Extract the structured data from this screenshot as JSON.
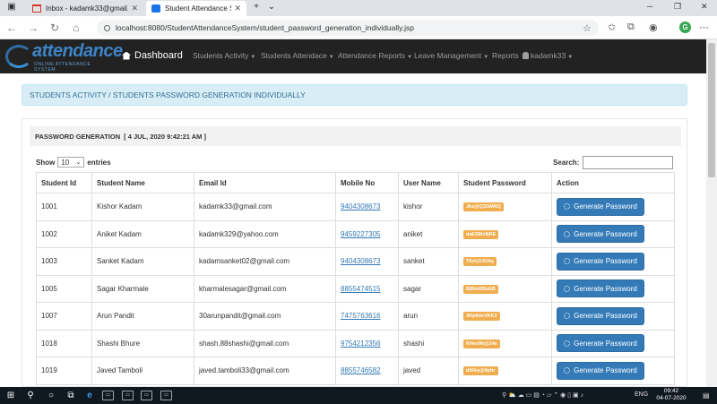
{
  "browser": {
    "tabs": [
      {
        "title": "Inbox - kadamk33@gmail.c",
        "active": false
      },
      {
        "title": "Student Attendance Sys",
        "active": true
      }
    ],
    "new_tab": "+",
    "url": "localhost:8080/StudentAttendanceSystem/student_password_generation_individually.jsp"
  },
  "navbar": {
    "logo_text": "attendance",
    "logo_sub": "ONLINE ATTENDANCE SYSTEM",
    "brand": "Dashboard",
    "items": [
      "Students Activity",
      "Students Attendace",
      "Attendance Reports",
      "Leave Management"
    ],
    "reports": "Reports",
    "user": "kadamk33"
  },
  "breadcrumb": "STUDENTS ACTIVITY / STUDENTS PASSWORD GENERATION INDIVIDUALLY",
  "panel": {
    "title": "PASSWORD GENERATION",
    "datetime": "[ 4 JUL, 2020 9:42:21 AM ]"
  },
  "table_controls": {
    "show_label": "Show",
    "show_value": "10",
    "entries_label": "entries",
    "search_label": "Search:"
  },
  "table": {
    "headers": [
      "Student Id",
      "Student Name",
      "Email Id",
      "Mobile No",
      "User Name",
      "Student Password",
      "Action"
    ],
    "action_label": "Generate Password",
    "rows": [
      {
        "id": "1001",
        "name": "Kishor Kadam",
        "email": "kadamk33@gmail.com",
        "mobile": "9404308673",
        "user": "kishor",
        "password": "Jks@Q3GMNQ"
      },
      {
        "id": "1002",
        "name": "Aniket Kadam",
        "email": "kadamk329@yahoo.com",
        "mobile": "9459227305",
        "user": "aniket",
        "password": "daESMz9jRE"
      },
      {
        "id": "1003",
        "name": "Sanket Kadam",
        "email": "kadamsanket02@gmail.com",
        "mobile": "9404308673",
        "user": "sanket",
        "password": "T6zty2JG6q"
      },
      {
        "id": "1005",
        "name": "Sagar Kharmale",
        "email": "kharmalesagar@gmail.com",
        "mobile": "8855474515",
        "user": "sagar",
        "password": "B8NxRBsEB"
      },
      {
        "id": "1007",
        "name": "Arun Pandit",
        "email": "30arunpandit@gmail.com",
        "mobile": "7475763616",
        "user": "arun",
        "password": "3Hp8dsVKK2"
      },
      {
        "id": "1018",
        "name": "Shashi Bhure",
        "email": "shash.88shashi@gmail.com",
        "mobile": "9754212356",
        "user": "shashi",
        "password": "KNev9k@24s"
      },
      {
        "id": "1019",
        "name": "Javed Tamboli",
        "email": "javed.tamboli33@gmail.com",
        "mobile": "8855746582",
        "user": "javed",
        "password": "dtKky@8phr"
      }
    ]
  },
  "taskbar": {
    "language": "ENG",
    "time": "09:42",
    "date": "04-07-2020"
  },
  "colors": {
    "navbar": "#222222",
    "breadcrumb_bg": "#d9edf7",
    "button": "#337ab7",
    "password_badge": "#f0ad4e",
    "link": "#337ab7"
  }
}
